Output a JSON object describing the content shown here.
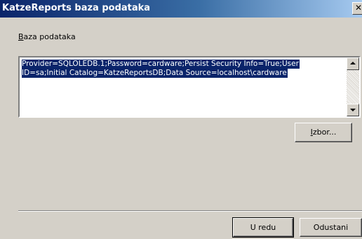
{
  "window": {
    "title": "KatzeReports baza podataka",
    "close_glyph": "✕"
  },
  "section": {
    "label_first": "B",
    "label_rest": "aza podataka"
  },
  "connection": {
    "line1": "Provider=SQLOLEDB.1;Password=cardware;Persist Security Info=True;User",
    "line2": "ID=sa;Initial Catalog=KatzeReportsDB;Data Source=localhost\\cardware",
    "selection_color": "#0a246a"
  },
  "buttons": {
    "izbor_first": "I",
    "izbor_rest": "zbor...",
    "ok": "U redu",
    "cancel": "Odustani"
  },
  "icons": {
    "close": "close-icon",
    "scroll_up": "scroll-up-arrow-icon",
    "scroll_down": "scroll-down-arrow-icon"
  },
  "colors": {
    "dialog_bg": "#d4d0c8",
    "titlebar_start": "#0a246a",
    "titlebar_end": "#a6caf0"
  }
}
